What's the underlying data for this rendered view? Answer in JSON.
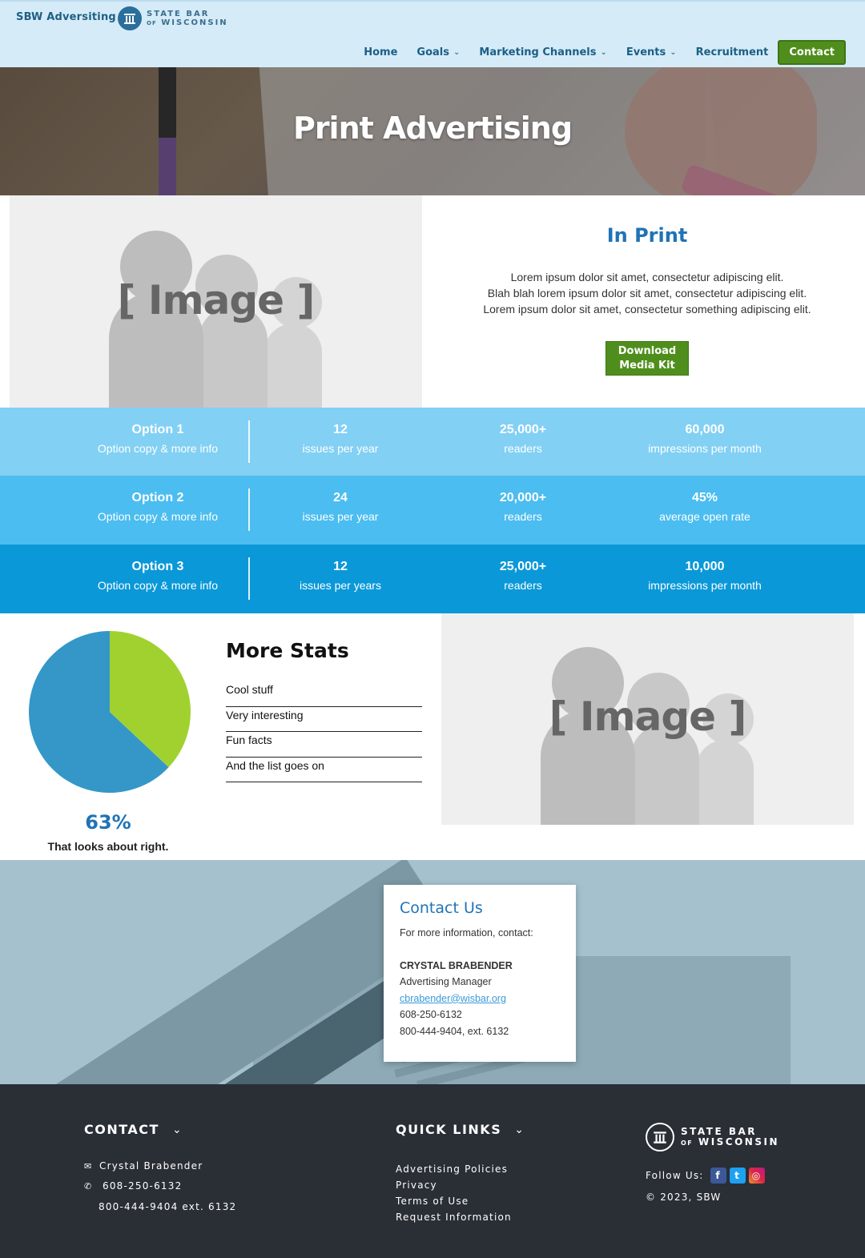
{
  "header": {
    "brand": "SBW Adversiting",
    "logo_line1": "STATE BAR",
    "logo_line2_small": "OF",
    "logo_line2": "WISCONSIN",
    "nav": [
      {
        "label": "Home",
        "has_dropdown": false
      },
      {
        "label": "Goals",
        "has_dropdown": true
      },
      {
        "label": "Marketing Channels",
        "has_dropdown": true
      },
      {
        "label": "Events",
        "has_dropdown": true
      },
      {
        "label": "Recruitment",
        "has_dropdown": false
      }
    ],
    "contact_label": "Contact"
  },
  "hero": {
    "title": "Print Advertising"
  },
  "image_placeholder": {
    "label": "[ Image ]"
  },
  "in_print": {
    "title": "In Print",
    "lines": [
      "Lorem ipsum dolor sit amet, consectetur adipiscing elit.",
      "Blah blah lorem ipsum dolor sit amet, consectetur adipiscing elit.",
      "Lorem ipsum dolor sit amet, consectetur something adipiscing elit."
    ],
    "button_line1": "Download",
    "button_line2": "Media Kit"
  },
  "options": [
    {
      "name": "Option 1",
      "copy": "Option copy & more info",
      "color": "#82d0f4",
      "stats": [
        {
          "value": "12",
          "label": "issues per year"
        },
        {
          "value": "25,000+",
          "label": "readers"
        },
        {
          "value": "60,000",
          "label": "impressions per month"
        }
      ]
    },
    {
      "name": "Option 2",
      "copy": "Option copy & more info",
      "color": "#4bbdf0",
      "stats": [
        {
          "value": "24",
          "label": "issues per year"
        },
        {
          "value": "20,000+",
          "label": "readers"
        },
        {
          "value": "45%",
          "label": "average open rate"
        }
      ]
    },
    {
      "name": "Option 3",
      "copy": "Option copy & more info",
      "color": "#0a98d8",
      "stats": [
        {
          "value": "12",
          "label": "issues per years"
        },
        {
          "value": "25,000+",
          "label": "readers"
        },
        {
          "value": "10,000",
          "label": "impressions per month"
        }
      ]
    }
  ],
  "stats": {
    "title": "More Stats",
    "items": [
      "Cool stuff",
      "Very interesting",
      "Fun facts",
      "And the list goes on"
    ],
    "percent_label": "63%",
    "caption": "That looks about right."
  },
  "chart_data": {
    "type": "pie",
    "slices": [
      {
        "value": 63,
        "color": "#3497c8"
      },
      {
        "value": 37,
        "color": "#a1d12f"
      }
    ]
  },
  "contact": {
    "title": "Contact Us",
    "intro": "For more information, contact:",
    "name": "CRYSTAL BRABENDER",
    "role": "Advertising Manager",
    "email": "cbrabender@wisbar.org",
    "phone1": "608-250-6132",
    "phone2": "800-444-9404, ext. 6132"
  },
  "footer": {
    "contact_heading": "CONTACT",
    "contact_name": "Crystal Brabender",
    "contact_phone1": "608-250-6132",
    "contact_phone2": "800-444-9404 ext. 6132",
    "links_heading": "QUICK LINKS",
    "links": [
      "Advertising Policies",
      "Privacy",
      "Terms of Use",
      "Request Information"
    ],
    "logo_line1": "STATE BAR",
    "logo_line2_small": "OF",
    "logo_line2": "WISCONSIN",
    "follow_label": "Follow Us:",
    "social": [
      {
        "icon": "facebook-icon",
        "glyph": "f",
        "color": "#3b5998"
      },
      {
        "icon": "twitter-icon",
        "glyph": "t",
        "color": "#1da1f2"
      },
      {
        "icon": "instagram-icon",
        "glyph": "◎",
        "color": "#d6336c"
      }
    ],
    "copyright": "© 2023, SBW"
  }
}
